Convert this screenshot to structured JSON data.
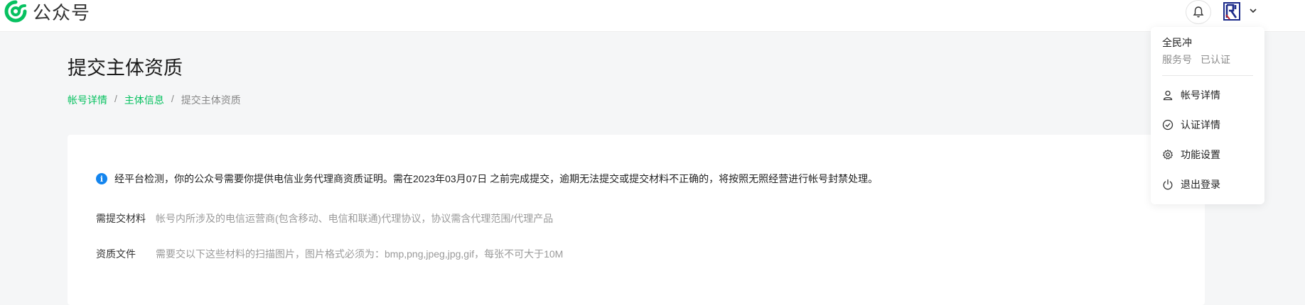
{
  "header": {
    "app_name": "公众号",
    "icons": [
      "wechat-mp-logo-icon",
      "bell-icon",
      "chevron-down-icon"
    ],
    "brand_color": "#07c160"
  },
  "page": {
    "title": "提交主体资质",
    "breadcrumb": [
      {
        "label": "帐号详情"
      },
      {
        "label": "主体信息"
      },
      {
        "label": "提交主体资质"
      }
    ],
    "separator": "/"
  },
  "card": {
    "notice": "经平台检测，你的公众号需要你提供电信业务代理商资质证明。需在2023年03月07日  之前完成提交，逾期无法提交或提交材料不正确的，将按照无照经营进行帐号封禁处理。",
    "info_icon_glyph": "i",
    "rows": [
      {
        "label": "需提交材料",
        "value": "帐号内所涉及的电信运营商(包含移动、电信和联通)代理协议，协议需含代理范围/代理产品"
      },
      {
        "label": "资质文件",
        "value": "需要交以下这些材料的扫描图片，图片格式必须为：bmp,png,jpeg,jpg,gif，每张不可大于10M"
      }
    ]
  },
  "dropdown": {
    "account_name": "全民冲",
    "account_type": "服务号",
    "verify_status": "已认证",
    "items": [
      {
        "label": "帐号详情",
        "icon": "user-icon"
      },
      {
        "label": "认证详情",
        "icon": "check-circle-icon"
      },
      {
        "label": "功能设置",
        "icon": "gear-icon"
      },
      {
        "label": "退出登录",
        "icon": "power-icon"
      }
    ]
  }
}
